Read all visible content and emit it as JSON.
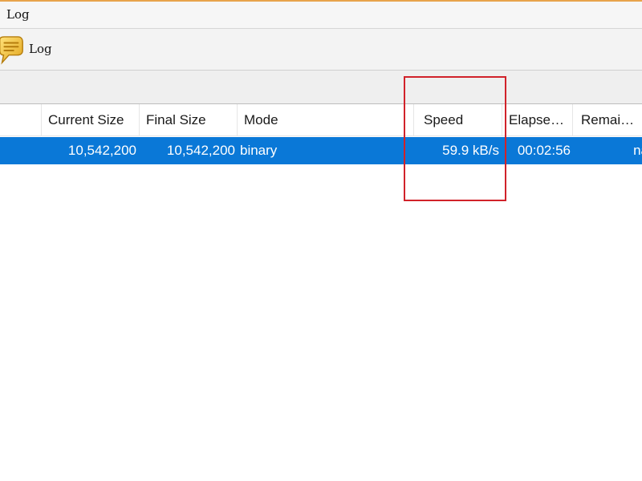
{
  "menubar": {
    "title": "Log"
  },
  "toolbar": {
    "log_label": "Log",
    "log_icon": "speech-bubble-icon"
  },
  "table": {
    "columns": [
      "",
      "Current Size",
      "Final Size",
      "Mode",
      "Speed",
      "Elapse…",
      "Remai…"
    ],
    "rows": [
      {
        "current_size": "10,542,200",
        "final_size": "10,542,200",
        "mode": "binary",
        "speed": "59.9 kB/s",
        "elapsed": "00:02:56",
        "remaining": "na",
        "selected": true
      }
    ]
  },
  "annotation": {
    "highlight_color": "#d1222a",
    "highlighted_column": "Speed"
  },
  "colors": {
    "selection": "#0a78d7",
    "menubar_accent": "#e8a34c"
  }
}
